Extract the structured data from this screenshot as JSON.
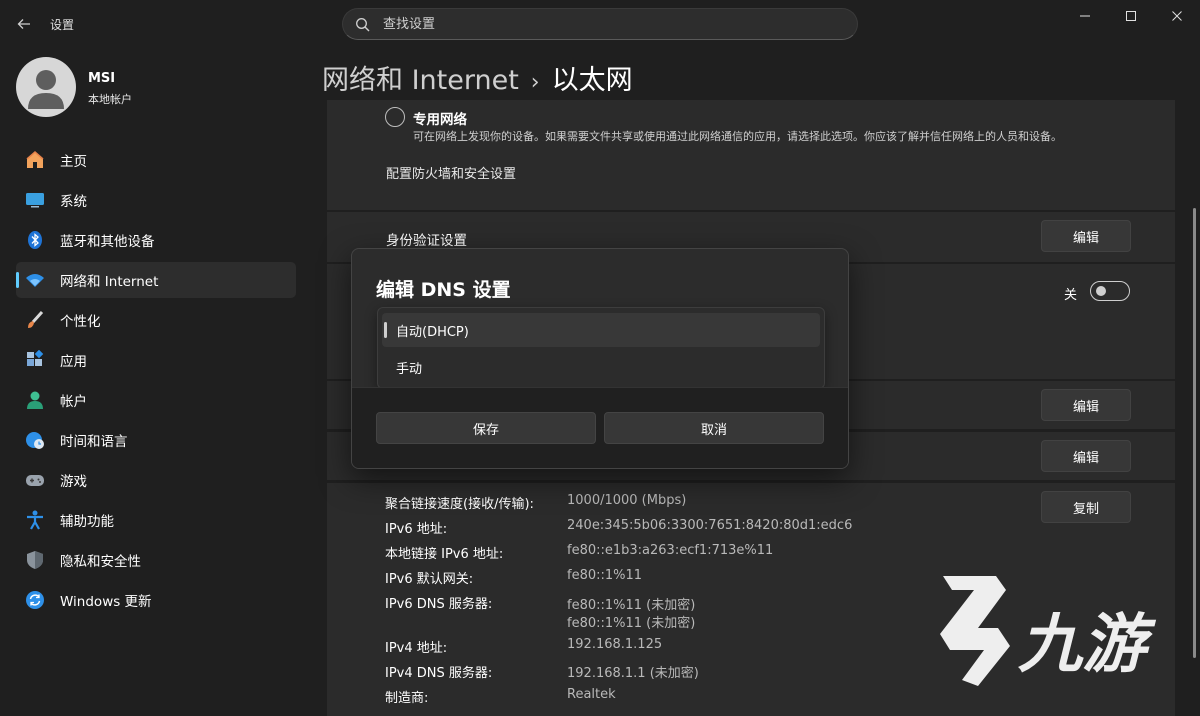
{
  "window": {
    "title": "设置",
    "back_icon": "back-arrow-icon"
  },
  "search": {
    "placeholder": "查找设置"
  },
  "profile": {
    "name": "MSI",
    "account_type": "本地帐户"
  },
  "sidebar": {
    "items": [
      {
        "label": "主页",
        "icon": "home-icon"
      },
      {
        "label": "系统",
        "icon": "monitor-icon"
      },
      {
        "label": "蓝牙和其他设备",
        "icon": "bluetooth-icon"
      },
      {
        "label": "网络和 Internet",
        "icon": "wifi-icon",
        "active": true
      },
      {
        "label": "个性化",
        "icon": "brush-icon"
      },
      {
        "label": "应用",
        "icon": "apps-icon"
      },
      {
        "label": "帐户",
        "icon": "person-icon"
      },
      {
        "label": "时间和语言",
        "icon": "globe-clock-icon"
      },
      {
        "label": "游戏",
        "icon": "gamepad-icon"
      },
      {
        "label": "辅助功能",
        "icon": "accessibility-icon"
      },
      {
        "label": "隐私和安全性",
        "icon": "shield-icon"
      },
      {
        "label": "Windows 更新",
        "icon": "update-icon"
      }
    ]
  },
  "breadcrumb": {
    "parent": "网络和 Internet",
    "separator": "›",
    "current": "以太网"
  },
  "network_profile": {
    "private_label": "专用网络",
    "private_desc": "可在网络上发现你的设备。如果需要文件共享或使用通过此网络通信的应用，请选择此选项。你应该了解并信任网络上的人员和设备。",
    "firewall_link": "配置防火墙和安全设置"
  },
  "auth": {
    "label": "身份验证设置",
    "edit": "编辑"
  },
  "metered": {
    "state": "关"
  },
  "edit_buttons": {
    "edit1": "编辑",
    "edit2": "编辑",
    "copy": "复制"
  },
  "properties": [
    {
      "key": "聚合链接速度(接收/传输):",
      "value": "1000/1000 (Mbps)"
    },
    {
      "key": "IPv6 地址:",
      "value": "240e:345:5b06:3300:7651:8420:80d1:edc6"
    },
    {
      "key": "本地链接 IPv6 地址:",
      "value": "fe80::e1b3:a263:ecf1:713e%11"
    },
    {
      "key": "IPv6 默认网关:",
      "value": "fe80::1%11"
    },
    {
      "key": "IPv6 DNS 服务器:",
      "value": "fe80::1%11 (未加密)",
      "value2": "fe80::1%11 (未加密)"
    },
    {
      "key": "IPv4 地址:",
      "value": "192.168.1.125"
    },
    {
      "key": "IPv4 DNS 服务器:",
      "value": "192.168.1.1 (未加密)"
    },
    {
      "key": "制造商:",
      "value": "Realtek"
    }
  ],
  "dialog": {
    "title": "编辑 DNS 设置",
    "options": [
      "自动(DHCP)",
      "手动"
    ],
    "selected": "自动(DHCP)",
    "save": "保存",
    "cancel": "取消"
  },
  "watermark": {
    "text": "九游"
  },
  "colors": {
    "accent": "#60cdff",
    "background": "#1f1f1f",
    "card": "#2b2b2b"
  }
}
